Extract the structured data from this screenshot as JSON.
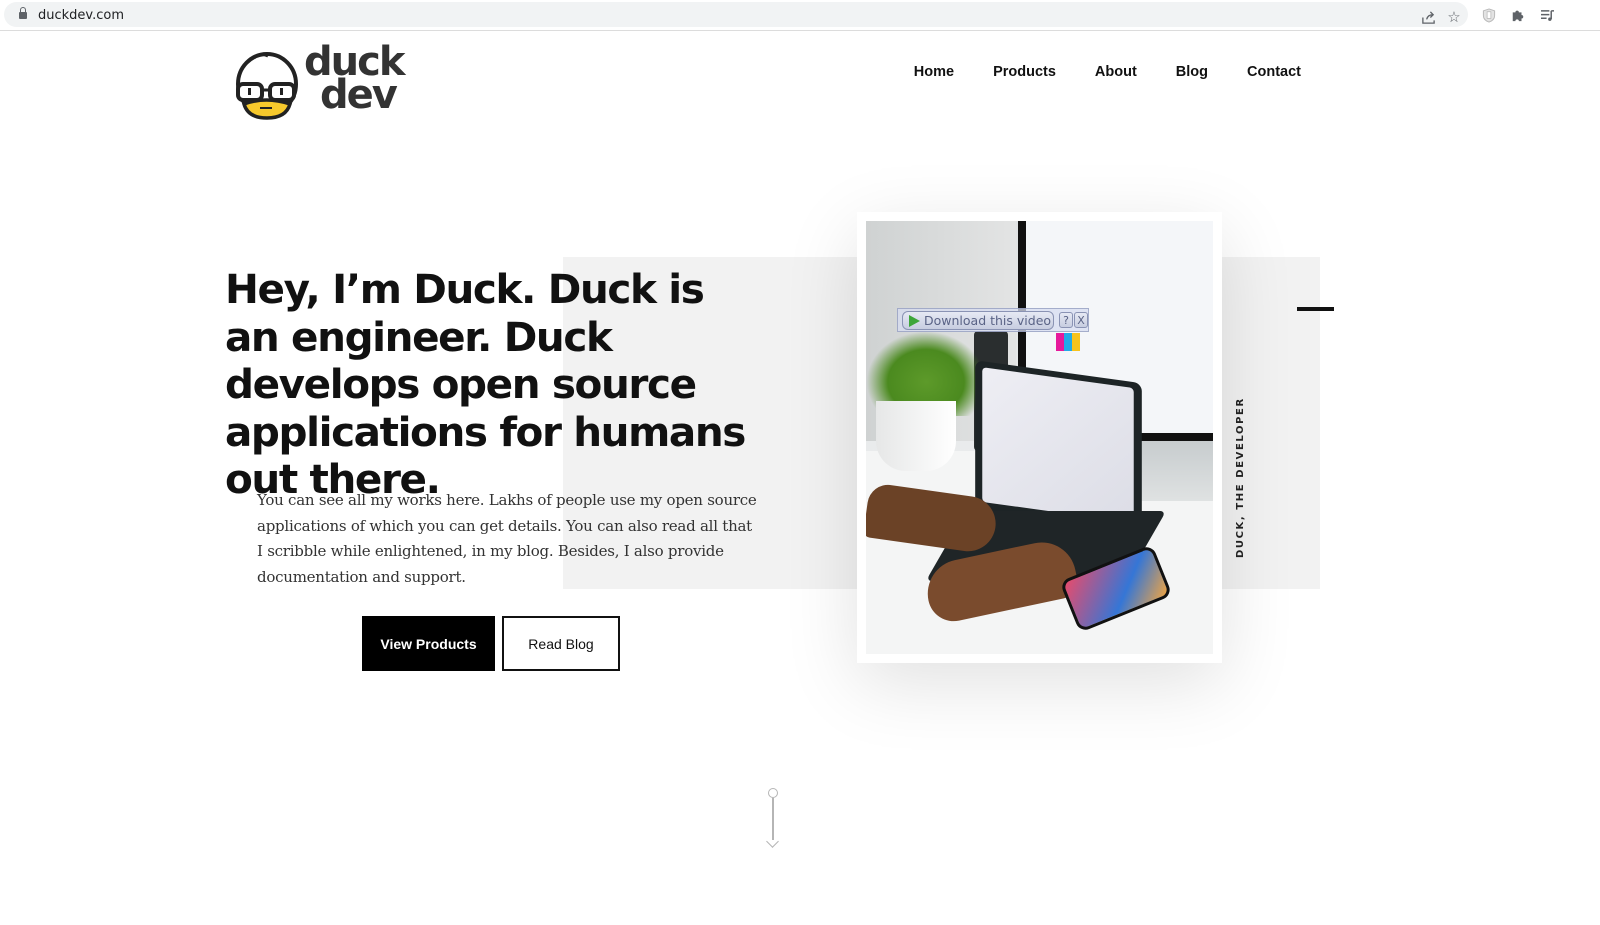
{
  "browser": {
    "url": "duckdev.com",
    "icons": [
      "lock-icon",
      "share-icon",
      "bookmark-star-icon",
      "shield-extension-icon",
      "extensions-puzzle-icon",
      "media-queue-icon"
    ]
  },
  "header": {
    "logo": {
      "line1": "duck",
      "line2": "dev"
    },
    "nav": [
      {
        "label": "Home"
      },
      {
        "label": "Products"
      },
      {
        "label": "About"
      },
      {
        "label": "Blog"
      },
      {
        "label": "Contact"
      }
    ]
  },
  "hero": {
    "title": "Hey, I’m Duck. Duck is an engineer. Duck develops open source applications for humans out there.",
    "description": "You can see all my works here. Lakhs of people use my open source applications of which you can get details. You can also read all that I scribble while enlightened, in my blog. Besides, I also provide documentation and support.",
    "primary_button": "View Products",
    "secondary_button": "Read Blog",
    "side_label": "DUCK, THE DEVELOPER"
  },
  "overlay": {
    "download_label": "Download this video",
    "help_label": "?",
    "close_label": "X"
  },
  "colors": {
    "accent": "#000000",
    "band": "#f2f2f2",
    "text": "#111111"
  }
}
